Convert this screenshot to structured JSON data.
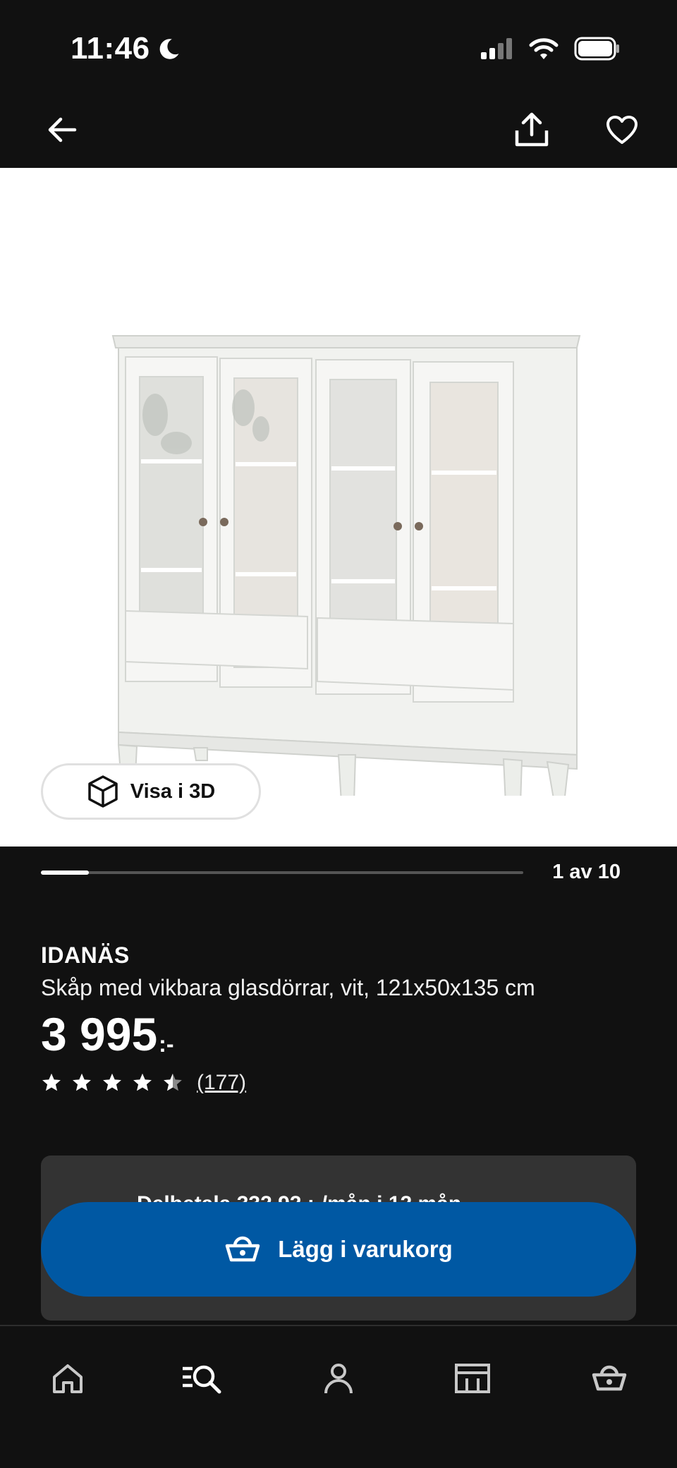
{
  "status_bar": {
    "time": "11:46"
  },
  "top_nav": {
    "back_icon": "arrow-left-icon",
    "share_icon": "share-icon",
    "favorite_icon": "heart-icon"
  },
  "gallery": {
    "view_3d_label": "Visa i 3D",
    "page_label": "1 av 10",
    "current_index": 1,
    "total": 10
  },
  "product": {
    "name": "IDANÄS",
    "description": "Skåp med vikbara glasdörrar, vit, 121x50x135 cm",
    "price": "3 995",
    "price_suffix": ":-",
    "rating": 4.5,
    "rating_max": 5,
    "review_count": "(177)"
  },
  "financing": {
    "text": "Delbetala 332,92 :-/mån i 12 mån"
  },
  "actions": {
    "add_to_cart_label": "Lägg i varukorg"
  },
  "bottom_nav": {
    "items": [
      "home-icon",
      "search-icon",
      "profile-icon",
      "store-icon",
      "basket-icon"
    ]
  },
  "colors": {
    "background": "#111111",
    "primary_button": "#0058a3",
    "card": "#333333"
  }
}
